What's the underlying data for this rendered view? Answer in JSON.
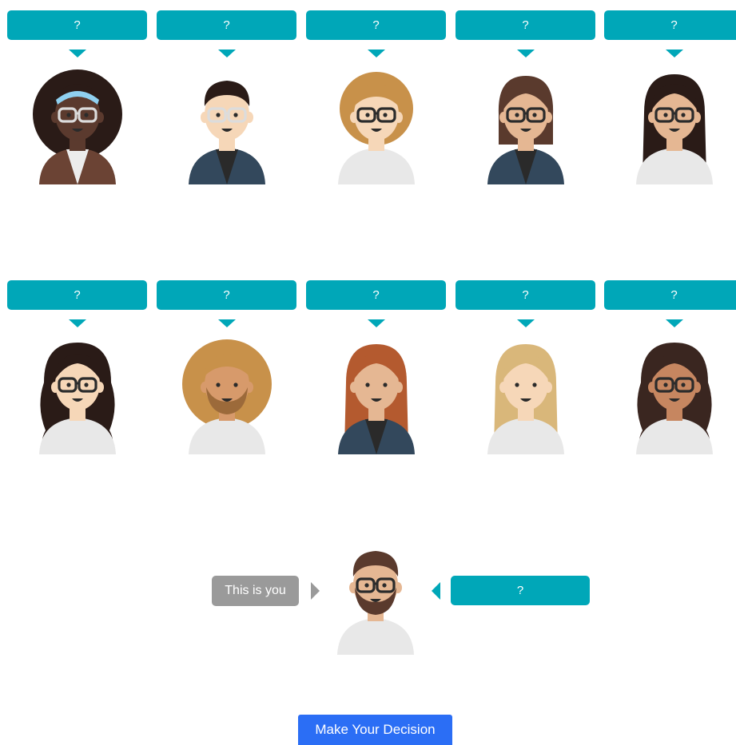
{
  "players": [
    {
      "id": "p1",
      "label": "?",
      "skin": "#5b3a2e",
      "hair": "#2a1b17",
      "hair_style": "afro",
      "shirt": "#ececec",
      "jacket": "#6b4334",
      "glasses": "#dcdcdc",
      "headband": "#8fd0f0"
    },
    {
      "id": "p2",
      "label": "?",
      "skin": "#f6d7b8",
      "hair": "#2a1b17",
      "hair_style": "short",
      "shirt": "#2a2a2a",
      "jacket": "#33485c",
      "glasses": "#dcdcdc"
    },
    {
      "id": "p3",
      "label": "?",
      "skin": "#f6d7b8",
      "hair": "#c8914a",
      "hair_style": "curly",
      "shirt": "#e8e8e8",
      "glasses": "#2b2b2b"
    },
    {
      "id": "p4",
      "label": "?",
      "skin": "#e5b793",
      "hair": "#5a3a2d",
      "hair_style": "bob",
      "shirt": "#2a2a2a",
      "jacket": "#33485c",
      "glasses": "#2b2b2b"
    },
    {
      "id": "p5",
      "label": "?",
      "skin": "#e5b793",
      "hair": "#2a1b17",
      "hair_style": "long",
      "shirt": "#e8e8e8",
      "glasses": "#2b2b2b"
    },
    {
      "id": "p6",
      "label": "?",
      "skin": "#f6d7b8",
      "hair": "#2a1b17",
      "hair_style": "wavy",
      "shirt": "#e8e8e8",
      "glasses": "#2b2b2b"
    },
    {
      "id": "p7",
      "label": "?",
      "skin": "#d79a6b",
      "hair": "#c8914a",
      "hair_style": "afro",
      "shirt": "#e8e8e8",
      "beard": "#9c6a3a"
    },
    {
      "id": "p8",
      "label": "?",
      "skin": "#e5b793",
      "hair": "#b45a2f",
      "hair_style": "long",
      "shirt": "#2a2a2a",
      "jacket": "#33485c"
    },
    {
      "id": "p9",
      "label": "?",
      "skin": "#f6d7b8",
      "hair": "#d9b77a",
      "hair_style": "long",
      "shirt": "#e8e8e8"
    },
    {
      "id": "p10",
      "label": "?",
      "skin": "#c68660",
      "hair": "#3a2620",
      "hair_style": "wavy",
      "shirt": "#e8e8e8",
      "glasses": "#2b2b2b"
    }
  ],
  "you": {
    "tag": "This is you",
    "label": "?",
    "skin": "#e5b793",
    "hair": "#5a3a2d",
    "hair_style": "short",
    "shirt": "#e8e8e8",
    "glasses": "#2b2b2b",
    "beard": "#5a3a2d"
  },
  "decision_button": "Make Your Decision",
  "colors": {
    "accent": "#00a7b8",
    "you_tag": "#9a9a9a",
    "button": "#2b6ef5"
  }
}
